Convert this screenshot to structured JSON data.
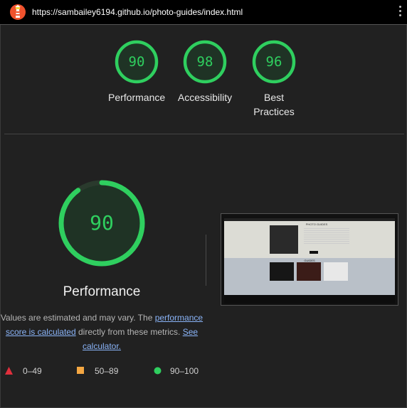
{
  "topbar": {
    "url": "https://sambailey6194.github.io/photo-guides/index.html",
    "logo_icon": "lighthouse-icon",
    "menu_icon": "kebab-menu-icon"
  },
  "gauges": [
    {
      "score": 90,
      "label": "Performance"
    },
    {
      "score": 98,
      "label": "Accessibility"
    },
    {
      "score": 96,
      "label": "Best Practices"
    }
  ],
  "main": {
    "score": 90,
    "title": "Performance",
    "desc_prefix": "Values are estimated and may vary. The ",
    "desc_link1": "performance score is calculated",
    "desc_middle": " directly from these metrics. ",
    "desc_link2": "See calculator."
  },
  "legend": {
    "fail": "0–49",
    "average": "50–89",
    "pass": "90–100"
  },
  "thumbnail": {
    "heading": "PHOTO GUIDES",
    "section": "GUIDES"
  },
  "colors": {
    "pass": "#2fcf5f",
    "average": "#f4a742",
    "fail": "#e02f3c",
    "background": "#212121"
  }
}
